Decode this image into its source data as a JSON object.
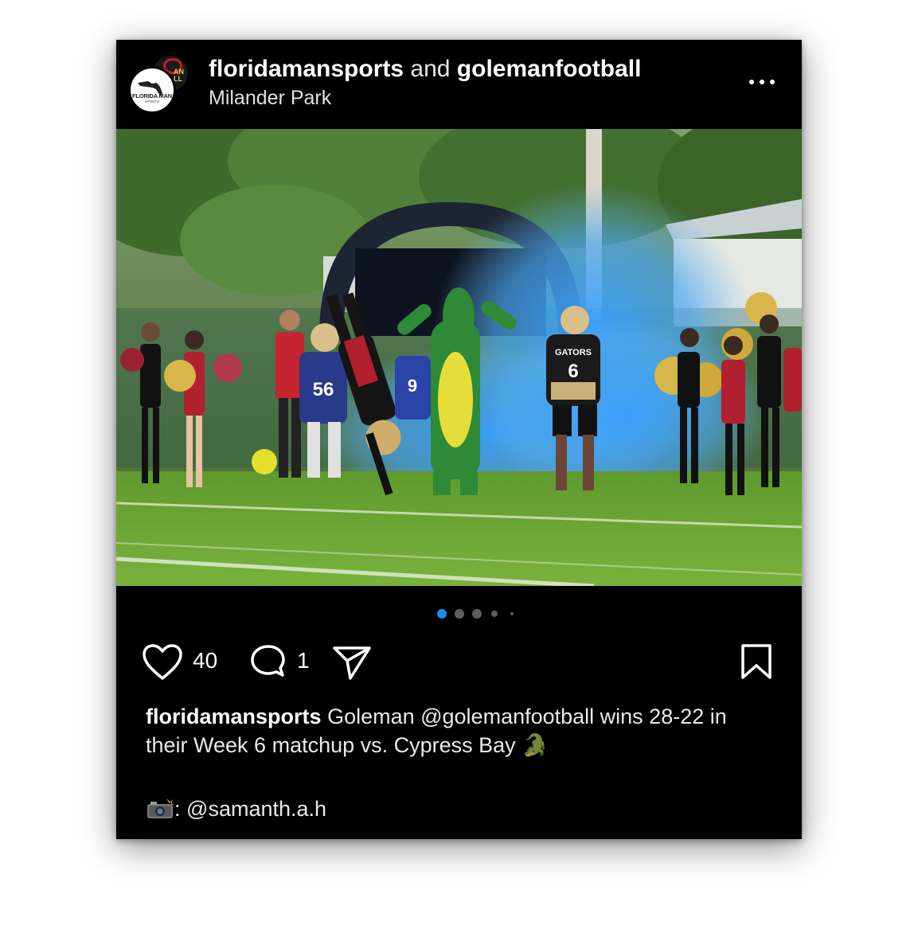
{
  "post": {
    "author_primary": "floridamansports",
    "joiner": "and",
    "author_secondary": "golemanfootball",
    "location": "Milander Park",
    "avatar_primary_text": "FLORIDA MAN",
    "avatar_primary_subtext": "SPORTS",
    "avatar_secondary_text": "AN\nLL"
  },
  "carousel": {
    "count": 5,
    "active_index": 0
  },
  "actions": {
    "likes": "40",
    "comments": "1"
  },
  "caption": {
    "username": "floridamansports",
    "text": "Goleman @golemanfootball wins 28-22 in their Week 6 matchup vs. Cypress Bay",
    "emoji": "🐊",
    "credit_prefix": ":",
    "credit_handle": "@samanth.a.h"
  },
  "photo": {
    "jersey_numbers": [
      "56",
      "9",
      "6"
    ],
    "team_name": "GATORS"
  },
  "colors": {
    "background": "#000000",
    "active_dot": "#1a8cf0",
    "inactive_dot": "#5e5e5e"
  },
  "icons": [
    "more-options-icon",
    "heart-icon",
    "comment-icon",
    "share-icon",
    "bookmark-icon",
    "camera-flash-icon"
  ]
}
